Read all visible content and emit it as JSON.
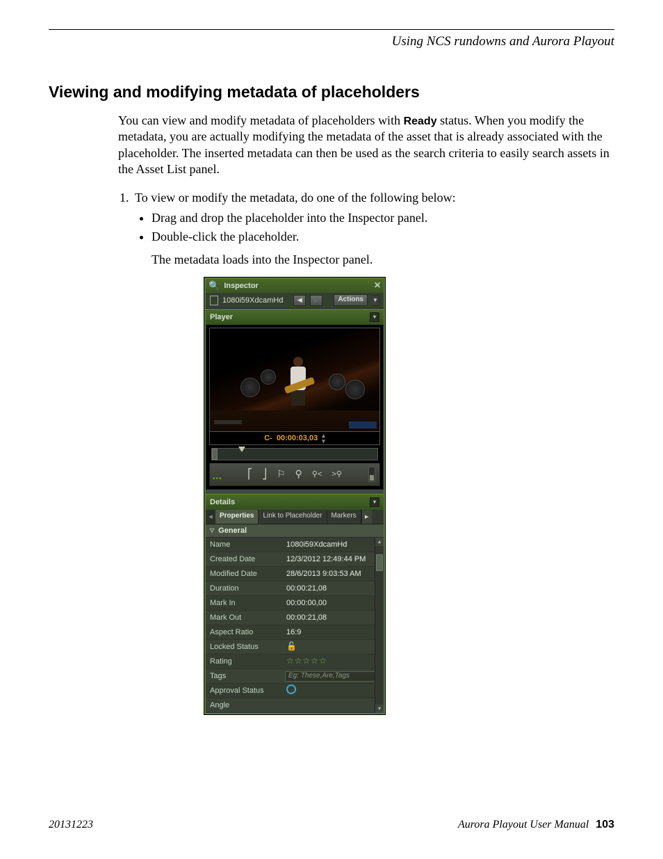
{
  "runningHead": "Using NCS rundowns and Aurora Playout",
  "heading": "Viewing and modifying metadata of placeholders",
  "intro_pre": "You can view and modify metadata of placeholders with ",
  "intro_bold": "Ready",
  "intro_post": " status. When you modify the metadata, you are actually modifying the metadata of the asset that is already associated with the placeholder. The inserted metadata can then be used as the search criteria to easily search assets in the Asset List panel.",
  "step1": "To view or modify the metadata, do one of the following below:",
  "bullet1": "Drag and drop the placeholder into the Inspector panel.",
  "bullet2": "Double-click the placeholder.",
  "afterBullets": "The metadata loads into the Inspector panel.",
  "inspector": {
    "title": "Inspector",
    "assetName": "1080i59XdcamHd",
    "actionsLabel": "Actions",
    "playerLabel": "Player",
    "timecodePrefix": "C-",
    "timecode": "00:00:03,03",
    "detailsLabel": "Details",
    "tabs": {
      "properties": "Properties",
      "link": "Link to Placeholder",
      "markers": "Markers"
    },
    "groupGeneral": "General",
    "rows": {
      "name": {
        "label": "Name",
        "value": "1080i59XdcamHd"
      },
      "created": {
        "label": "Created Date",
        "value": "12/3/2012 12:49:44 PM"
      },
      "modified": {
        "label": "Modified Date",
        "value": "28/6/2013 9:03:53 AM"
      },
      "duration": {
        "label": "Duration",
        "value": "00:00:21,08"
      },
      "markin": {
        "label": "Mark In",
        "value": "00:00:00,00"
      },
      "markout": {
        "label": "Mark Out",
        "value": "00:00:21,08"
      },
      "aspect": {
        "label": "Aspect Ratio",
        "value": "16:9"
      },
      "locked": {
        "label": "Locked Status"
      },
      "rating": {
        "label": "Rating"
      },
      "tags": {
        "label": "Tags",
        "placeholder": "Eg: These,Are,Tags"
      },
      "approval": {
        "label": "Approval Status"
      },
      "angle": {
        "label": "Angle",
        "value": ""
      }
    }
  },
  "footer": {
    "date": "20131223",
    "manual": "Aurora Playout   User Manual",
    "page": "103"
  }
}
